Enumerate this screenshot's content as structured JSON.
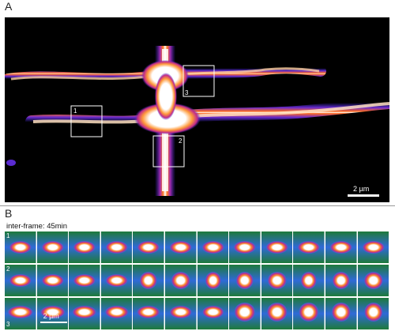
{
  "panels": {
    "a": {
      "letter": "A",
      "scale_bar": "2 µm",
      "boxes": [
        {
          "label": "1"
        },
        {
          "label": "2"
        },
        {
          "label": "3"
        }
      ]
    },
    "b": {
      "letter": "B",
      "caption": "inter-frame: 45min",
      "scale_bar": "2 µm",
      "rows": [
        {
          "label": "1",
          "frames": 12
        },
        {
          "label": "2",
          "frames": 12
        },
        {
          "label": "3",
          "frames": 12
        }
      ]
    }
  },
  "colors": {
    "background": "#000000",
    "signal_low": "#3b2bd0",
    "signal_mid": "#ff6a1a",
    "signal_high": "#ffffff",
    "tile_bg_low": "#1e7a3a",
    "tile_bg_high": "#2f6ad8"
  }
}
